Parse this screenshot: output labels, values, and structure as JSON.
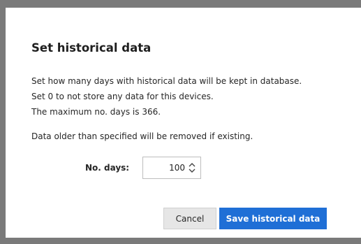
{
  "dialog": {
    "title": "Set historical data",
    "lines": [
      "Set how many days with historical data will be kept in database.",
      "Set 0 to not store any data for this devices.",
      "The maximum no. days is 366.",
      "Data older than specified will be removed if existing."
    ],
    "days_label": "No. days:",
    "days_value": "100",
    "cancel_label": "Cancel",
    "save_label": "Save historical data"
  },
  "colors": {
    "primary": "#1f6fd6",
    "overlay": "#7a7a7a",
    "secondary_button": "#e6e6e6"
  },
  "icons": {
    "spinner": "up-down-chevron-icon"
  }
}
